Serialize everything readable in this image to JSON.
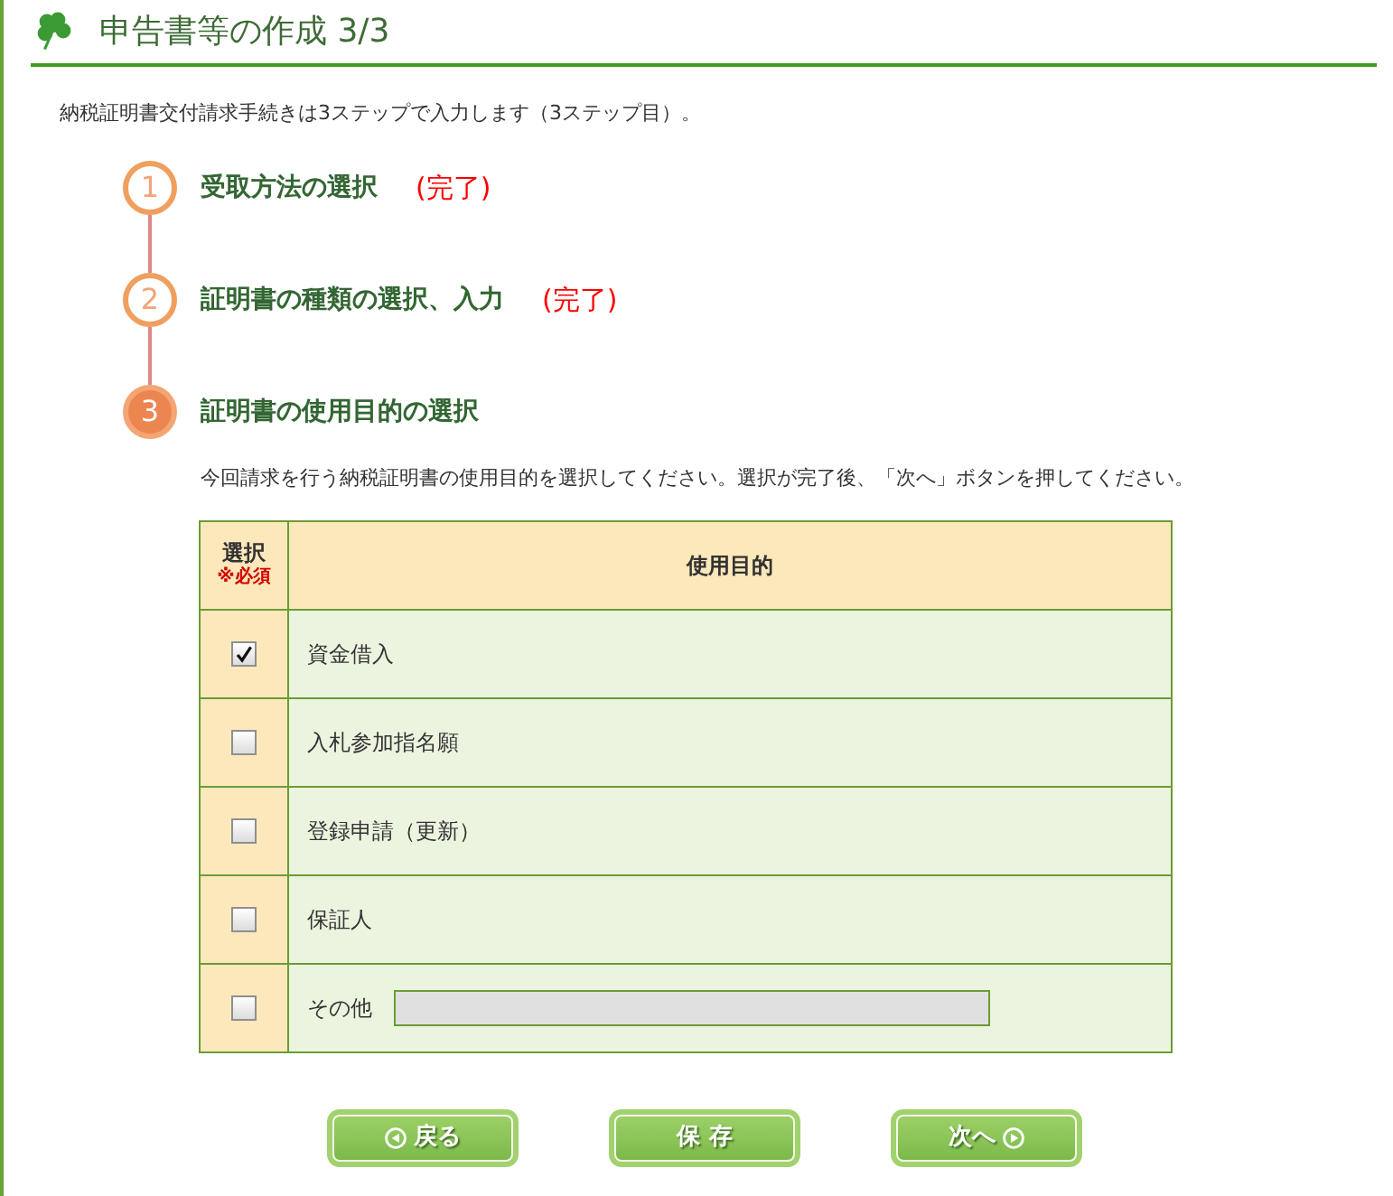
{
  "header": {
    "title": "申告書等の作成 3/3"
  },
  "intro": "納税証明書交付請求手続きは3ステップで入力します（3ステップ目）。",
  "steps": [
    {
      "number": "1",
      "label": "受取方法の選択",
      "status": "(完了)",
      "current": false
    },
    {
      "number": "2",
      "label": "証明書の種類の選択、入力",
      "status": "(完了)",
      "current": false
    },
    {
      "number": "3",
      "label": "証明書の使用目的の選択",
      "current": true
    }
  ],
  "instruction": "今回請求を行う納税証明書の使用目的を選択してください。選択が完了後、「次へ」ボタンを押してください。",
  "table": {
    "columns": [
      {
        "label": "選択",
        "note": "※必須"
      },
      {
        "label": "使用目的"
      }
    ],
    "rows": [
      {
        "kind": "plain",
        "label": "資金借入",
        "checked": true
      },
      {
        "kind": "plain",
        "label": "入札参加指名願",
        "checked": false
      },
      {
        "kind": "plain",
        "label": "登録申請（更新）",
        "checked": false
      },
      {
        "kind": "plain",
        "label": "保証人",
        "checked": false
      },
      {
        "kind": "other",
        "label": "その他",
        "checked": false,
        "input": {
          "disabled": true
        }
      }
    ]
  },
  "buttons": [
    {
      "kind": "back",
      "label": "戻る"
    },
    {
      "kind": "save",
      "label": "保 存"
    },
    {
      "kind": "next",
      "label": "次へ"
    }
  ]
}
